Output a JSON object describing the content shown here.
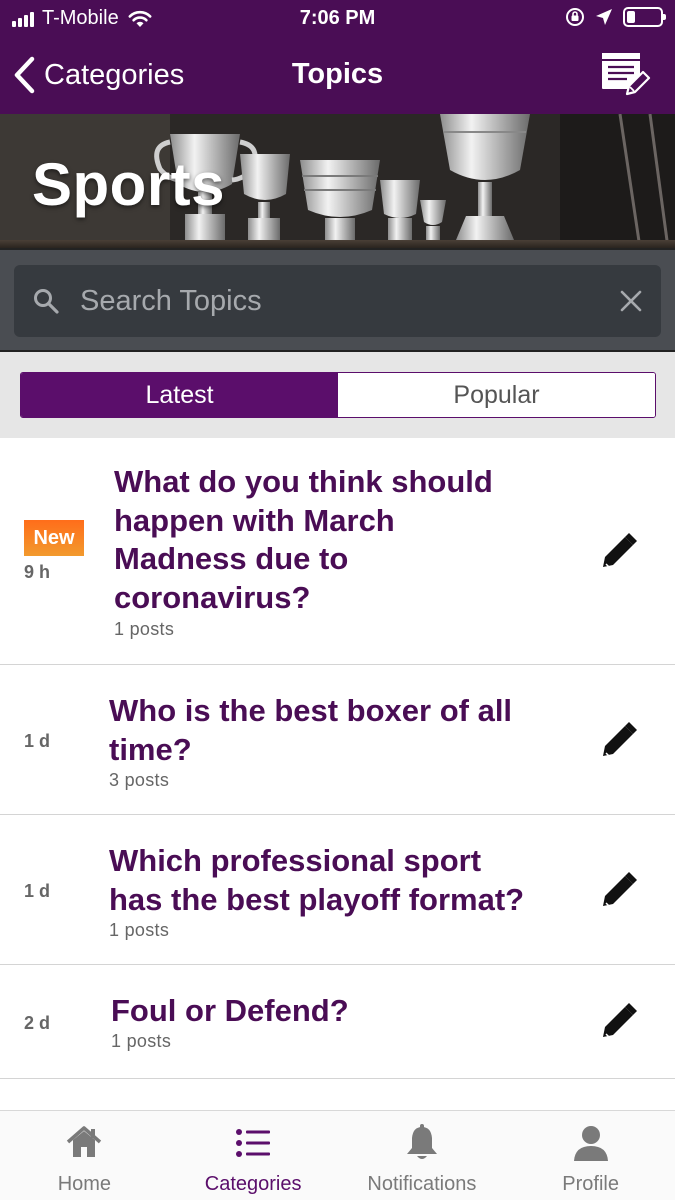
{
  "status_bar": {
    "carrier": "T-Mobile",
    "time": "7:06 PM"
  },
  "nav": {
    "back_label": "Categories",
    "title": "Topics",
    "compose_icon": "compose-icon"
  },
  "hero": {
    "title": "Sports"
  },
  "search": {
    "placeholder": "Search Topics",
    "value": ""
  },
  "segments": {
    "latest": "Latest",
    "popular": "Popular",
    "selected": "Latest"
  },
  "topics": [
    {
      "badge": "New",
      "age": "9 h",
      "title_lines": [
        "What do you think should",
        "happen with March",
        "Madness due to",
        "coronavirus?"
      ],
      "posts": "1 posts"
    },
    {
      "badge": "",
      "age": "1 d",
      "title_lines": [
        "Who is the best boxer of all",
        "time?"
      ],
      "posts": "3 posts"
    },
    {
      "badge": "",
      "age": "1 d",
      "title_lines": [
        "Which professional sport",
        "has the best playoff format?"
      ],
      "posts": "1 posts"
    },
    {
      "badge": "",
      "age": "2 d",
      "title_lines": [
        "Foul or Defend?"
      ],
      "posts": "1 posts"
    }
  ],
  "tabs": [
    {
      "label": "Home",
      "icon": "home-icon"
    },
    {
      "label": "Categories",
      "icon": "list-icon"
    },
    {
      "label": "Notifications",
      "icon": "bell-icon"
    },
    {
      "label": "Profile",
      "icon": "person-icon"
    }
  ],
  "colors": {
    "brand_purple": "#4a0d55",
    "segment_purple": "#5b0e6b",
    "new_badge": "#ff6d1a"
  }
}
